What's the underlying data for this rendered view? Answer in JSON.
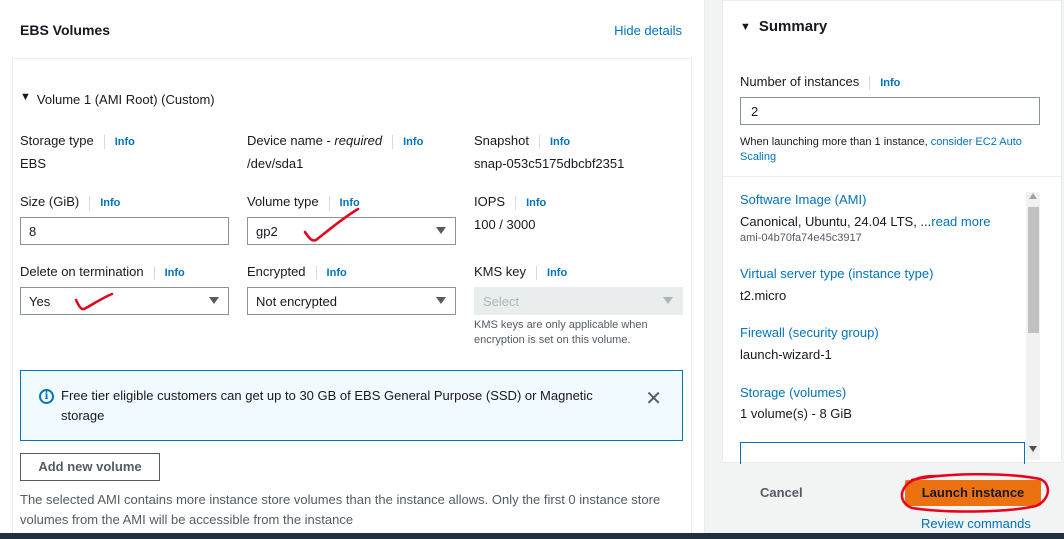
{
  "ebs": {
    "title": "EBS Volumes",
    "hide_details": "Hide details",
    "volume_title": "Volume 1 (AMI Root) (Custom)",
    "storage_type": {
      "label": "Storage type",
      "info": "Info",
      "value": "EBS"
    },
    "device_name": {
      "label": "Device name - ",
      "required": "required",
      "info": "Info",
      "value": "/dev/sda1"
    },
    "snapshot": {
      "label": "Snapshot",
      "info": "Info",
      "value": "snap-053c5175dbcbf2351"
    },
    "size": {
      "label": "Size (GiB)",
      "info": "Info",
      "value": "8"
    },
    "volume_type": {
      "label": "Volume type",
      "info": "Info",
      "value": "gp2"
    },
    "iops": {
      "label": "IOPS",
      "info": "Info",
      "value": "100 / 3000"
    },
    "delete_on_termination": {
      "label": "Delete on termination",
      "info": "Info",
      "value": "Yes"
    },
    "encrypted": {
      "label": "Encrypted",
      "info": "Info",
      "value": "Not encrypted"
    },
    "kms_key": {
      "label": "KMS key",
      "info": "Info",
      "placeholder": "Select",
      "note": "KMS keys are only applicable when encryption is set on this volume."
    },
    "alert": {
      "text": "Free tier eligible customers can get up to 30 GB of EBS General Purpose (SSD) or Magnetic storage",
      "close": "✕",
      "icon": "info-icon"
    },
    "add_volume": "Add new volume",
    "warning": "The selected AMI contains more instance store volumes than the instance allows. Only the first 0 instance store volumes from the AMI will be accessible from the instance"
  },
  "summary": {
    "title": "Summary",
    "num_instances_label": "Number of instances",
    "num_instances_info": "Info",
    "num_instances_value": "2",
    "num_note_prefix": "When launching more than 1 instance, ",
    "num_note_link": "consider EC2 Auto Scaling",
    "ami_label": "Software Image (AMI)",
    "ami_value": "Canonical, Ubuntu, 24.04 LTS, ...",
    "ami_read_more": "read more",
    "ami_id": "ami-04b70fa74e45c3917",
    "instance_type_label": "Virtual server type (instance type)",
    "instance_type_value": "t2.micro",
    "firewall_label": "Firewall (security group)",
    "firewall_value": "launch-wizard-1",
    "storage_label": "Storage (volumes)",
    "storage_value": "1 volume(s) - 8 GiB",
    "cancel": "Cancel",
    "launch": "Launch instance",
    "review": "Review commands"
  },
  "colors": {
    "link": "#0073bb",
    "launch": "#ec7211",
    "annotation": "#e8001c"
  }
}
